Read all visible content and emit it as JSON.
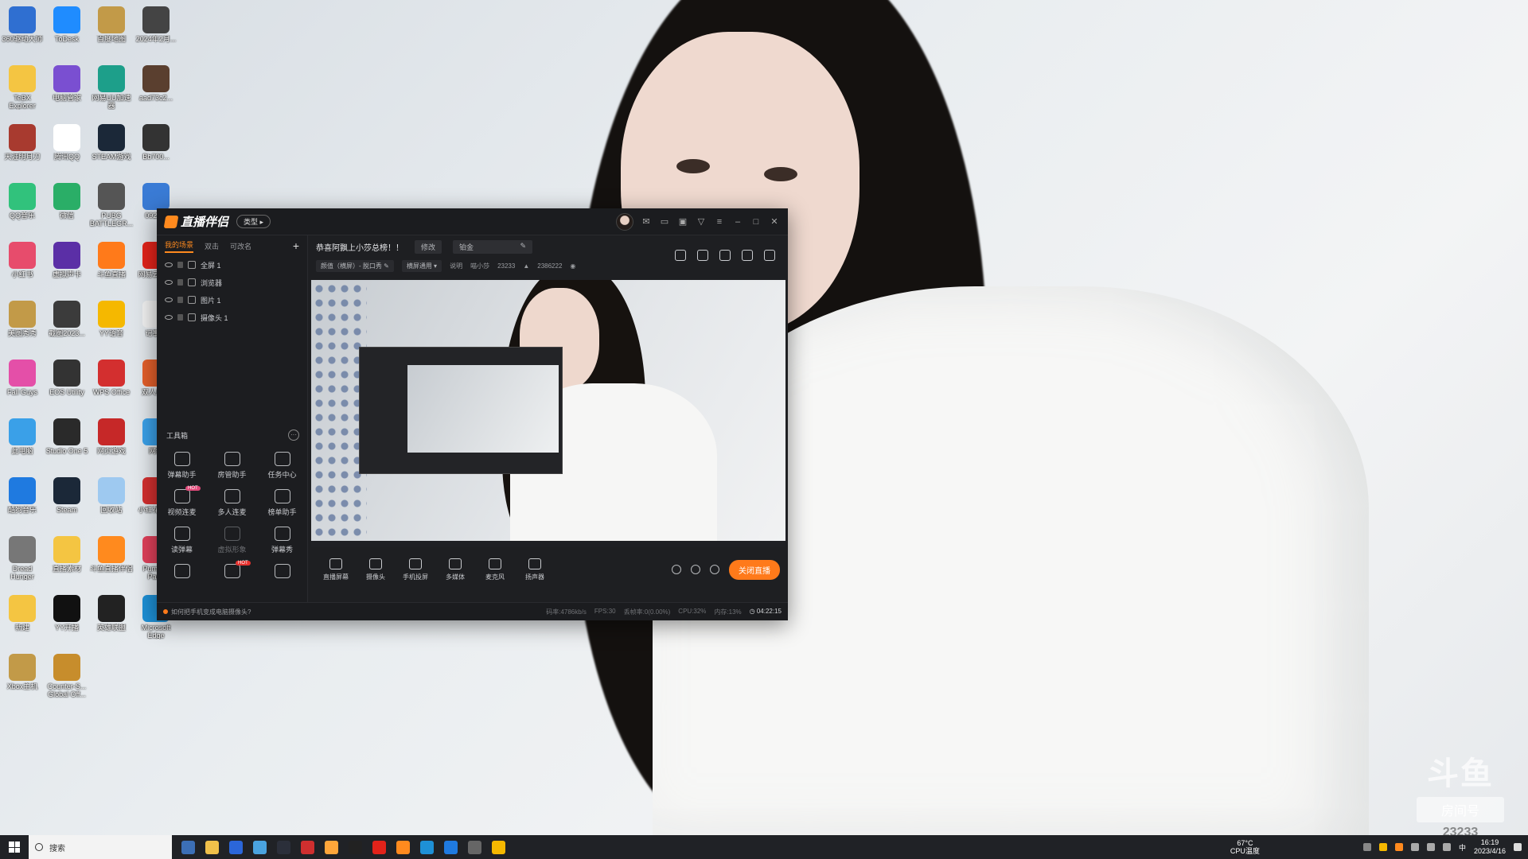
{
  "wallpaper": {
    "watermark": {
      "logo": "斗鱼",
      "badge": "房间号",
      "room": "23233"
    }
  },
  "desktop": {
    "icons": [
      {
        "label": "360驱动大师",
        "color": "#2f6fd1"
      },
      {
        "label": "ToDesk",
        "color": "#1f8cff"
      },
      {
        "label": "百度地图",
        "color": "#c29a48"
      },
      {
        "label": "2024年2月...",
        "color": "#444"
      },
      {
        "label": "TeBX Explorer",
        "color": "#f4c542"
      },
      {
        "label": "电脑管家",
        "color": "#7a4fd1"
      },
      {
        "label": "网易UU加速器",
        "color": "#1d9f8a"
      },
      {
        "label": "aad73c2...",
        "color": "#5a3f2f"
      },
      {
        "label": "天涯明月刀",
        "color": "#a83a2f"
      },
      {
        "label": "腾讯QQ",
        "color": "#ffffff"
      },
      {
        "label": "STEAM游戏",
        "color": "#1b2838"
      },
      {
        "label": "Bb700...",
        "color": "#333"
      },
      {
        "label": "QQ音乐",
        "color": "#31c27c"
      },
      {
        "label": "微信",
        "color": "#2aae67"
      },
      {
        "label": "PUBG BATTLEGR...",
        "color": "#555"
      },
      {
        "label": "0922...",
        "color": "#3a7bd5"
      },
      {
        "label": "小红书",
        "color": "#e74c6c"
      },
      {
        "label": "虚拟声卡",
        "color": "#5b2fa6"
      },
      {
        "label": "斗鱼直播",
        "color": "#ff7a1a"
      },
      {
        "label": "网易云音乐",
        "color": "#e2231a"
      },
      {
        "label": "美图秀秀",
        "color": "#c29a48"
      },
      {
        "label": "截图2023...",
        "color": "#3b3b3b"
      },
      {
        "label": "YY语音",
        "color": "#f5b800"
      },
      {
        "label": "记事本",
        "color": "#f0f0f0"
      },
      {
        "label": "Fall Guys",
        "color": "#e44fa8"
      },
      {
        "label": "EOS Utility",
        "color": "#333"
      },
      {
        "label": "WPS Office",
        "color": "#d32f2f"
      },
      {
        "label": "双人成行",
        "color": "#e35f2a"
      },
      {
        "label": "此电脑",
        "color": "#3aa0e8"
      },
      {
        "label": "Studio One 5",
        "color": "#2a2a2a"
      },
      {
        "label": "网页游戏",
        "color": "#c62828"
      },
      {
        "label": "网络",
        "color": "#3aa0e8"
      },
      {
        "label": "酷狗音乐",
        "color": "#1f7ae0"
      },
      {
        "label": "Steam",
        "color": "#1b2838"
      },
      {
        "label": "回收站",
        "color": "#9ec9f0"
      },
      {
        "label": "小红花助手",
        "color": "#d32f2f"
      },
      {
        "label": "Dread Hunger",
        "color": "#777"
      },
      {
        "label": "直播素材",
        "color": "#f4c542"
      },
      {
        "label": "斗鱼直播伴侣",
        "color": "#ff8a1e"
      },
      {
        "label": "Pummel Party",
        "color": "#e0405a"
      },
      {
        "label": "新建",
        "color": "#f4c542"
      },
      {
        "label": "YY开播",
        "color": "#111"
      },
      {
        "label": "英雄联盟",
        "color": "#222"
      },
      {
        "label": "Microsoft Edge",
        "color": "#1e90d6"
      },
      {
        "label": "Xbox主机",
        "color": "#c29a48"
      },
      {
        "label": "Counter-S... Global Off...",
        "color": "#c78d2c"
      }
    ]
  },
  "app": {
    "title": "直播伴侣",
    "badge": "类型 ▸",
    "sidebar": {
      "tabs": [
        "我的场景",
        "双击",
        "可改名"
      ],
      "scenes": [
        "全屏 1",
        "浏览器",
        "图片 1",
        "摄像头 1"
      ],
      "toolbox_label": "工具箱",
      "tools": [
        {
          "label": "弹幕助手",
          "hot": ""
        },
        {
          "label": "房管助手",
          "hot": ""
        },
        {
          "label": "任务中心",
          "hot": ""
        },
        {
          "label": "视频连麦",
          "hot": "HOT"
        },
        {
          "label": "多人连麦",
          "hot": ""
        },
        {
          "label": "榜单助手",
          "hot": ""
        },
        {
          "label": "读弹幕",
          "hot": ""
        },
        {
          "label": "虚拟形象",
          "hot": ""
        },
        {
          "label": "弹幕秀",
          "hot": ""
        },
        {
          "label": "",
          "hot": ""
        },
        {
          "label": "",
          "hot": "HOT"
        },
        {
          "label": "",
          "hot": ""
        }
      ]
    },
    "room": {
      "title": "恭喜阿飘上小莎总榜！！",
      "edit_label": "修改",
      "rank_label": "铂金",
      "category": "颜值（横屏）- 脱口秀",
      "orientation": "横屏通用",
      "explain": "说明",
      "host": "喵小莎",
      "room_id": "23233",
      "hot": "2386222"
    },
    "controls": [
      "直播屏幕",
      "摄像头",
      "手机投屏",
      "多媒体",
      "麦克风",
      "扬声器"
    ],
    "live_button": "关闭直播",
    "status": {
      "tip": "如何把手机变成电脑摄像头?",
      "bitrate": "码率:4786kb/s",
      "fps": "FPS:30",
      "dropped": "丢帧率:0(0.00%)",
      "cpu": "CPU:32%",
      "mem": "内存:13%",
      "time": "04:22:15"
    }
  },
  "taskbar": {
    "search_placeholder": "搜索",
    "apps": [
      "#3c6fb6",
      "#f0c04a",
      "#2b66d9",
      "#4aa3df",
      "#2b2f3a",
      "#cf2f2f",
      "#ffa63a",
      "#222",
      "#e2231a",
      "#ff8a1e",
      "#1e90d6",
      "#1f7ae0",
      "#666",
      "#f5b800"
    ],
    "cpu_temp": "67°C",
    "cpu_label": "CPU温度",
    "ime": "中",
    "time": "16:19",
    "date": "2023/4/16"
  }
}
